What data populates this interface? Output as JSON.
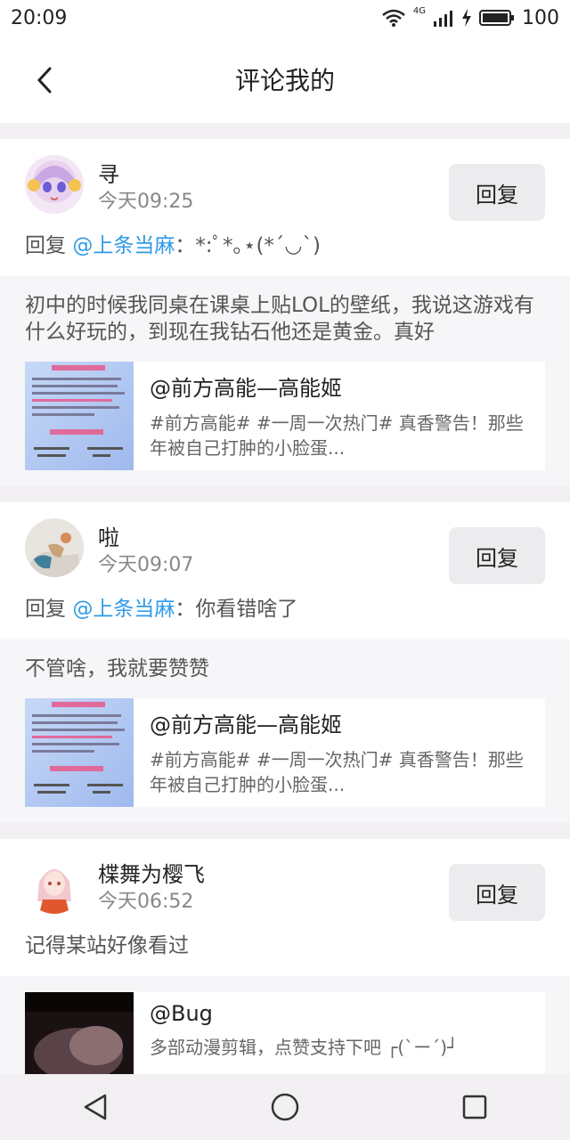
{
  "status_bar": {
    "time": "20:09",
    "network": "4G",
    "battery": "100"
  },
  "header": {
    "title": "评论我的"
  },
  "comments": [
    {
      "username": "寻",
      "time": "今天09:25",
      "reply_label": "回复",
      "reply_prefix": "回复 ",
      "mention": "@上条当麻",
      "reply_text": "：*:ﾟ*｡⋆(*´◡`)",
      "quoted_text": "初中的时候我同桌在课桌上贴LOL的壁纸，我说这游戏有什么好玩的，到现在我钻石他还是黄金。真好",
      "ref_title": "@前方高能—高能姬",
      "ref_desc": "#前方高能# #一周一次热门# 真香警告！那些年被自己打肿的小脸蛋..."
    },
    {
      "username": "啦",
      "time": "今天09:07",
      "reply_label": "回复",
      "reply_prefix": "回复 ",
      "mention": "@上条当麻",
      "reply_text": "：你看错啥了",
      "quoted_text": "不管啥，我就要赞赞",
      "ref_title": "@前方高能—高能姬",
      "ref_desc": "#前方高能# #一周一次热门# 真香警告！那些年被自己打肿的小脸蛋..."
    },
    {
      "username": "楪舞为樱飞",
      "time": "今天06:52",
      "reply_label": "回复",
      "plain_text": "记得某站好像看过",
      "ref_title": "@Bug",
      "ref_desc": "多部动漫剪辑，点赞支持下吧 ┌(`ー´)┘"
    }
  ],
  "colors": {
    "mention": "#2f9be8",
    "background": "#f2f0f3"
  }
}
